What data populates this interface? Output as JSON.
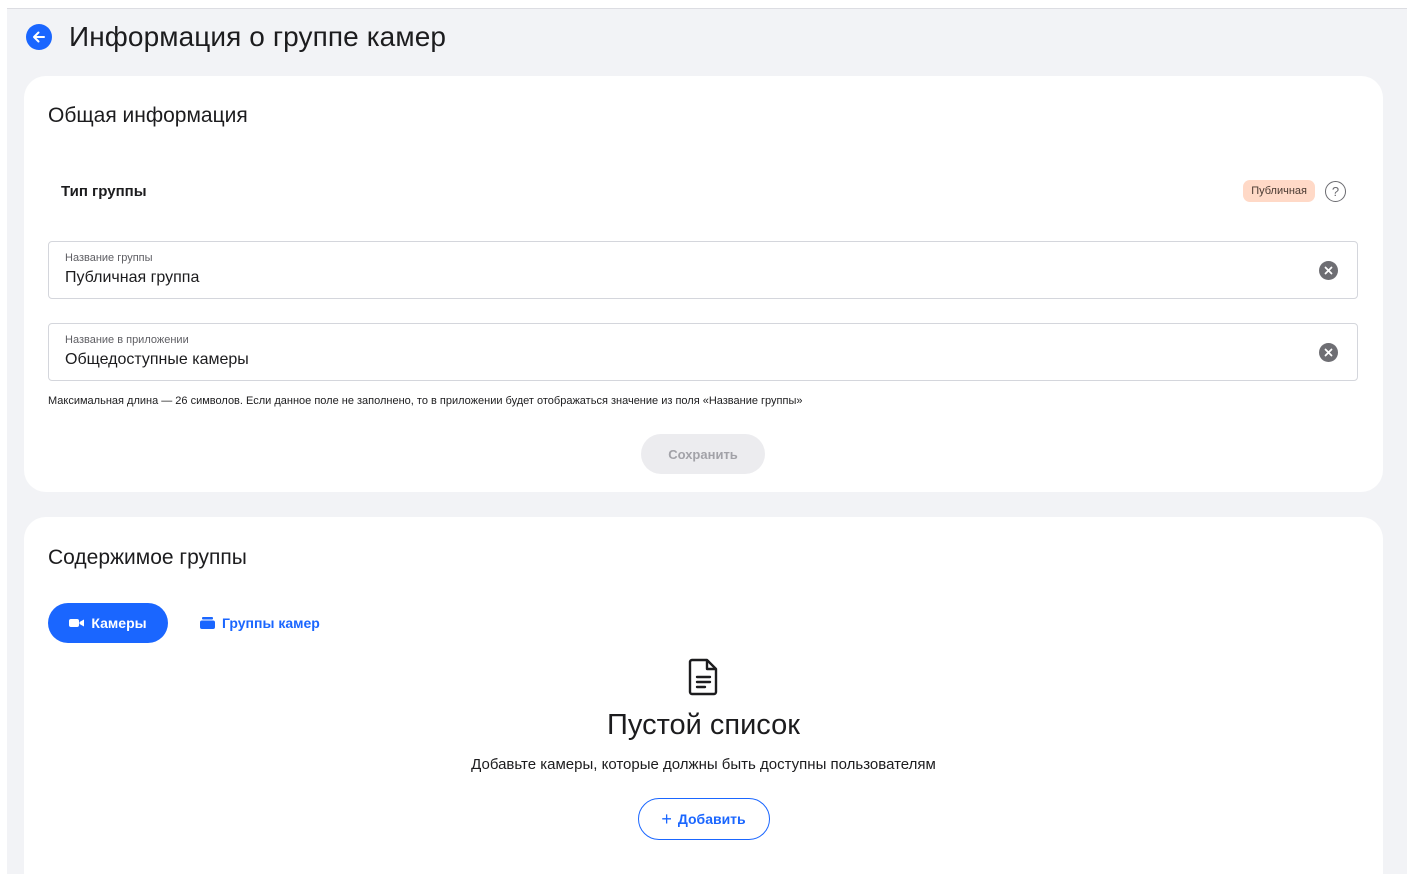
{
  "header": {
    "title": "Информация о группе камер",
    "back_icon": "arrow-left-icon"
  },
  "general": {
    "title": "Общая информация",
    "type_label": "Тип группы",
    "type_badge": "Публичная",
    "help_icon_text": "?",
    "group_name_label": "Название группы",
    "group_name_value": "Публичная группа",
    "app_name_label": "Название в приложении",
    "app_name_value": "Общедоступные камеры",
    "hint": "Максимальная длина — 26 символов. Если данное поле не заполнено, то в приложении будет отображаться значение из поля «Название группы»",
    "save_label": "Сохранить"
  },
  "content": {
    "title": "Содержимое группы",
    "tabs": [
      {
        "label": "Камеры",
        "icon": "video-camera-icon",
        "active": true
      },
      {
        "label": "Группы камер",
        "icon": "folder-stack-icon",
        "active": false
      }
    ],
    "empty_icon": "document-icon",
    "empty_title": "Пустой список",
    "empty_desc": "Добавьте камеры, которые должны быть доступны пользователям",
    "add_plus": "+",
    "add_label": "Добавить"
  },
  "colors": {
    "accent": "#1a66ff",
    "badge_bg": "#ffd9c7",
    "page_bg": "#f2f3f6"
  }
}
